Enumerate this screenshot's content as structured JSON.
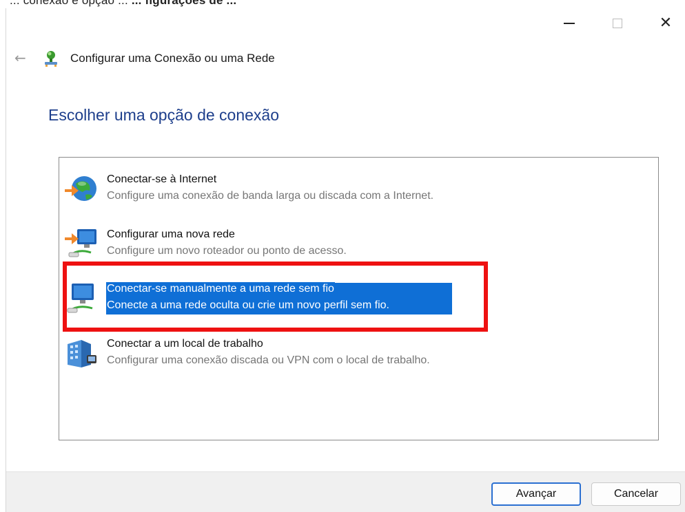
{
  "top_caption": {
    "prefix": "... conexão e opção ... ",
    "bold": "... figurações de ... "
  },
  "window": {
    "caption_buttons": {
      "minimize_icon": "minimize-icon",
      "maximize_icon": "maximize-icon",
      "close_glyph": "✕"
    }
  },
  "header": {
    "back_glyph": "←",
    "title": "Configurar uma Conexão ou uma Rede"
  },
  "main": {
    "heading": "Escolher uma opção de conexão",
    "options": [
      {
        "title": "Conectar-se à Internet",
        "description": "Configure uma conexão de banda larga ou discada com a Internet.",
        "icon": "globe-internet-icon",
        "selected": false
      },
      {
        "title": "Configurar uma nova rede",
        "description": "Configure um novo roteador ou ponto de acesso.",
        "icon": "new-network-icon",
        "selected": false
      },
      {
        "title": "Conectar-se manualmente a uma rede sem fio",
        "description": "Conecte a uma rede oculta ou crie um novo perfil sem fio.",
        "icon": "wireless-network-icon",
        "selected": true
      },
      {
        "title": "Conectar a um local de trabalho",
        "description": "Configurar uma conexão discada ou VPN com o local de trabalho.",
        "icon": "workplace-vpn-icon",
        "selected": false
      }
    ]
  },
  "footer": {
    "next_label": "Avançar",
    "cancel_label": "Cancelar"
  },
  "colors": {
    "heading": "#1e3f8c",
    "selection": "#0f6fd6",
    "annotation_frame": "#ee1111"
  }
}
